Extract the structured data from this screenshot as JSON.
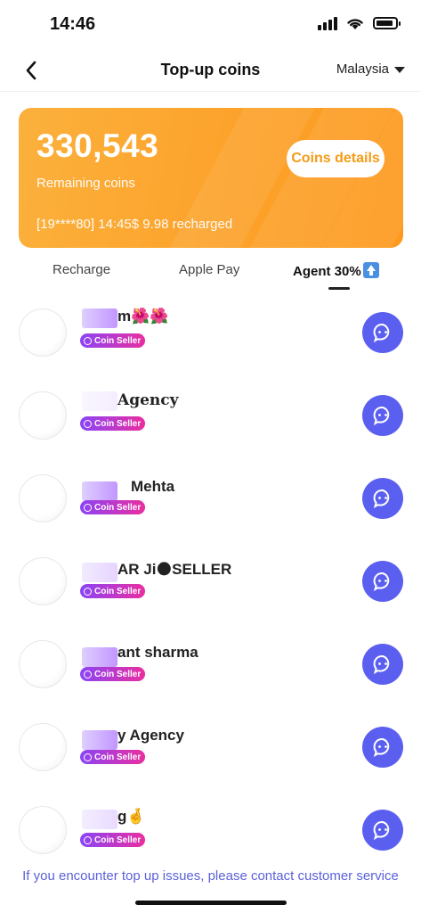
{
  "status_bar": {
    "time": "14:46"
  },
  "nav": {
    "title": "Top-up coins",
    "region": "Malaysia"
  },
  "balance": {
    "amount": "330,543",
    "label": "Remaining coins",
    "last_recharge": "[19****80] 14:45$ 9.98 recharged",
    "details_button": "Coins details"
  },
  "tabs": [
    {
      "label": "Recharge"
    },
    {
      "label": "Apple Pay"
    },
    {
      "label": "Agent 30%",
      "active": true
    }
  ],
  "sellers": [
    {
      "name": "m🌺🌺",
      "badge": "Coin Seller"
    },
    {
      "name": "Agency",
      "badge": "Coin Seller"
    },
    {
      "name": "Mehta",
      "badge": "Coin Seller"
    },
    {
      "name": "AR Ji🌑SELLER",
      "badge": "Coin Seller"
    },
    {
      "name": "ant sharma",
      "badge": "Coin Seller"
    },
    {
      "name": "y Agency",
      "badge": "Coin Seller"
    },
    {
      "name": "g🤞",
      "badge": "Coin Seller"
    }
  ],
  "footer": {
    "note": "If you encounter top up issues, please contact customer service"
  },
  "colors": {
    "accent": "#fca22b",
    "chat": "#5b5ff0",
    "link": "#5b62d9"
  }
}
